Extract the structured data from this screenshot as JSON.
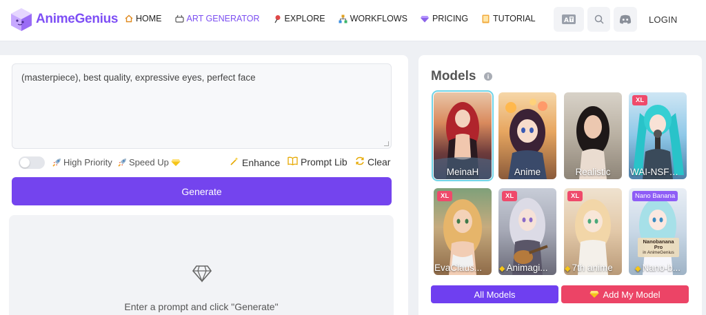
{
  "brand": {
    "name": "AnimeGenius",
    "accent": "#7444ee"
  },
  "nav": [
    {
      "label": "HOME",
      "icon": "home-icon",
      "active": false
    },
    {
      "label": "ART GENERATOR",
      "icon": "palette-icon",
      "active": true
    },
    {
      "label": "EXPLORE",
      "icon": "pin-icon",
      "active": false
    },
    {
      "label": "WORKFLOWS",
      "icon": "flow-icon",
      "active": false
    },
    {
      "label": "PRICING",
      "icon": "gem-icon",
      "active": false
    },
    {
      "label": "TUTORIAL",
      "icon": "book-icon",
      "active": false
    }
  ],
  "header": {
    "login": "LOGIN"
  },
  "prompt": {
    "value": "(masterpiece), best quality, expressive eyes, perfect face",
    "high_priority": "High Priority",
    "speed_up": "Speed Up",
    "enhance": "Enhance",
    "prompt_lib": "Prompt Lib",
    "clear": "Clear"
  },
  "generate_label": "Generate",
  "result_hint": "Enter a prompt and click \"Generate\"",
  "models": {
    "title": "Models",
    "info": "i",
    "cards": [
      {
        "name": "MeinaH",
        "badge": "",
        "premium": false,
        "selected": true
      },
      {
        "name": "Anime",
        "badge": "",
        "premium": false,
        "selected": false
      },
      {
        "name": "Realistic",
        "badge": "",
        "premium": false,
        "selected": false
      },
      {
        "name": "WAI-NSFW-...",
        "badge": "XL",
        "premium": false,
        "selected": false
      },
      {
        "name": "EvaClaus...",
        "badge": "XL",
        "premium": false,
        "selected": false
      },
      {
        "name": "Animagi...",
        "badge": "XL",
        "premium": true,
        "selected": false
      },
      {
        "name": "7th anime",
        "badge": "XL",
        "premium": true,
        "selected": false
      },
      {
        "name": "Nano-b...",
        "badge": "Nano Banana",
        "premium": true,
        "selected": false
      }
    ],
    "nano_overlay": [
      "Nanobanana",
      "Pro",
      "in AnimeGenius"
    ],
    "all_models": "All Models",
    "add_model": "Add My Model"
  }
}
